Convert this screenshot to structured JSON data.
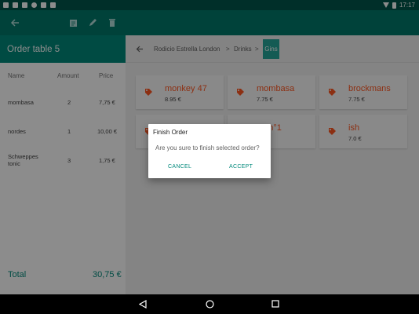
{
  "status_bar": {
    "time": "17:17",
    "left_icons": [
      "android-icon",
      "image-icon",
      "mail-icon",
      "sync-icon",
      "photo-icon",
      "bag-icon"
    ],
    "right_icons": [
      "wifi-icon",
      "battery-icon"
    ]
  },
  "toolbar": {
    "icons": [
      "back-arrow-icon",
      "receipt-icon",
      "edit-icon",
      "delete-icon"
    ],
    "color": "#00796b"
  },
  "order": {
    "title": "Order table 5",
    "columns": [
      "Name",
      "Amount",
      "Price"
    ],
    "items": [
      {
        "name": "mombasa",
        "amount": "2",
        "price": "7,75 €"
      },
      {
        "name": "nordes",
        "amount": "1",
        "price": "10,00 €"
      },
      {
        "name": "Schweppes tonic",
        "amount": "3",
        "price": "1,75 €"
      }
    ],
    "total_label": "Total",
    "total_value": "30,75 €"
  },
  "breadcrumb": {
    "items": [
      "Rodicio Estrella London",
      "Drinks",
      "Gins"
    ],
    "separator": ">"
  },
  "products": [
    {
      "name": "monkey 47",
      "price": "8.95 €"
    },
    {
      "name": "mombasa",
      "price": "7.75 €"
    },
    {
      "name": "brockmans",
      "price": "7.75 €"
    },
    {
      "name": "",
      "price": ""
    },
    {
      "name": "on n°1",
      "price": ""
    },
    {
      "name": "ish",
      "price": "7.0 €"
    }
  ],
  "dialog": {
    "title": "Finish Order",
    "message": "Are you sure to finish selected order?",
    "cancel": "CANCEL",
    "accept": "ACCEPT"
  },
  "nav": {
    "icons": [
      "nav-back-icon",
      "nav-home-icon",
      "nav-recents-icon"
    ]
  },
  "colors": {
    "status_bar": "#00574b",
    "primary": "#00897b",
    "accent": "#ff5722"
  }
}
